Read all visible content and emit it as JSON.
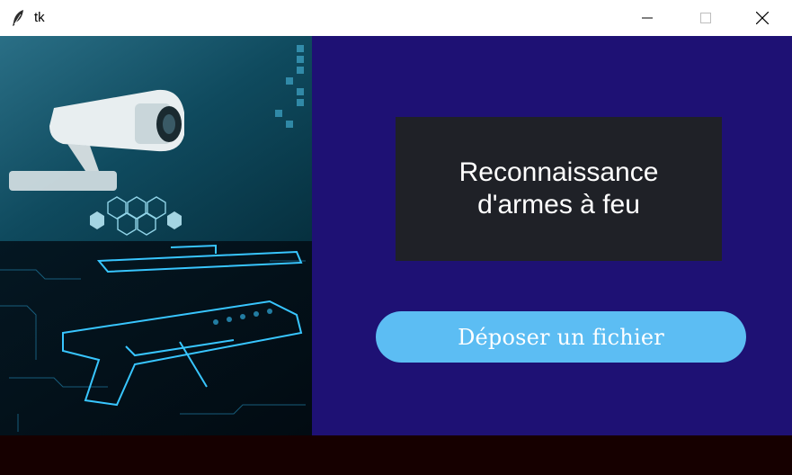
{
  "window": {
    "title": "tk",
    "icon": "feather-icon"
  },
  "title_controls": {
    "minimize_icon": "minimize-icon",
    "maximize_icon": "maximize-icon",
    "close_icon": "close-icon"
  },
  "main": {
    "heading": "Reconnaissance\nd'armes à feu",
    "upload_button_label": "Déposer un fichier"
  },
  "colors": {
    "panel_bg": "#1e1174",
    "heading_box_bg": "#1f2127",
    "button_bg": "#5cbdf3",
    "bottom_bar": "#160000",
    "image_accent": "#38c6ff"
  }
}
